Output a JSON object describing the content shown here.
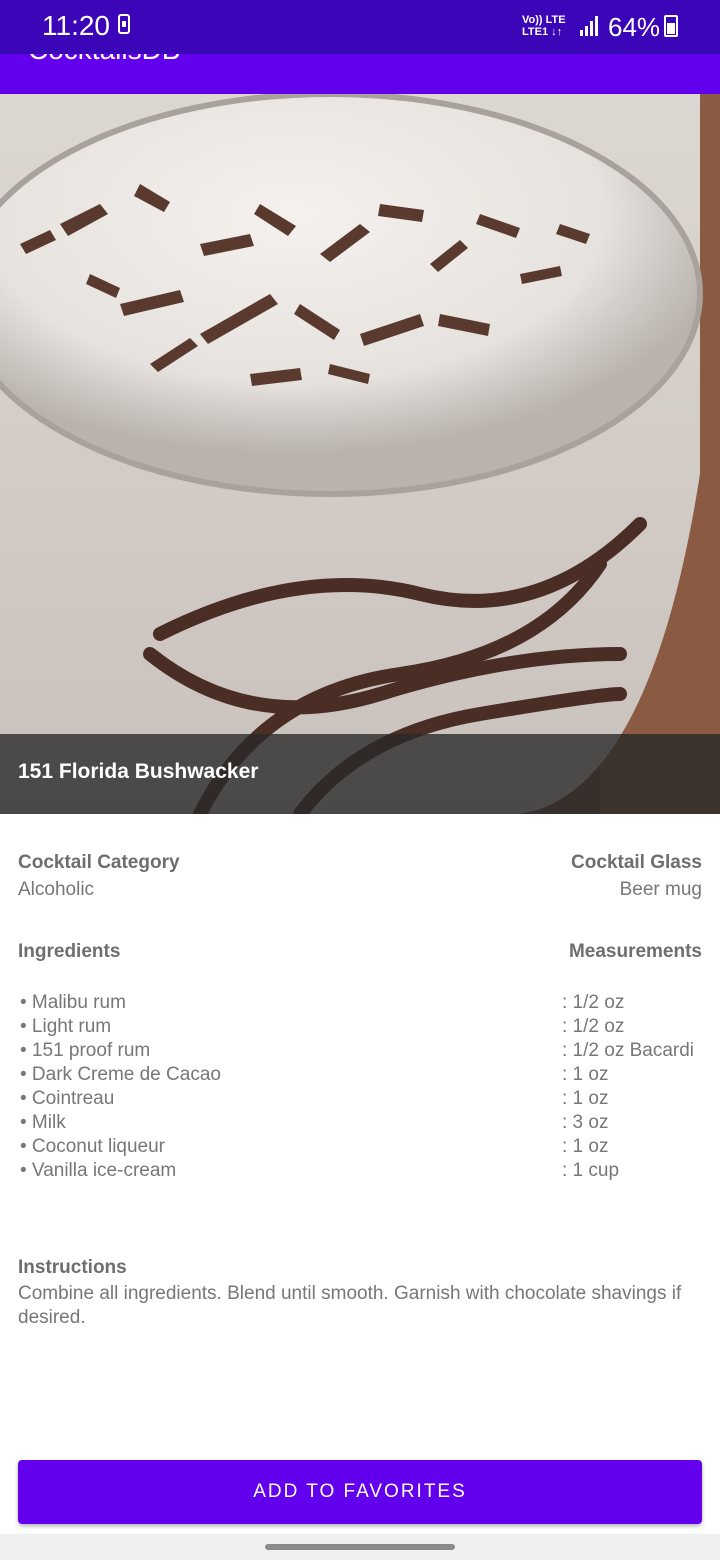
{
  "status_bar": {
    "time": "11:20",
    "network_top": "Vo)) LTE",
    "network_bottom": "LTE1 ↓↑",
    "battery": "64%"
  },
  "app_bar": {
    "title": "CocktailsDB"
  },
  "drink": {
    "name": "151 Florida Bushwacker",
    "image_icon": "cocktail-photo",
    "category_label": "Cocktail Category",
    "category": "Alcoholic",
    "glass_label": "Cocktail Glass",
    "glass": "Beer mug"
  },
  "ingredients_section": {
    "ingredients_label": "Ingredients",
    "measurements_label": "Measurements",
    "ingredients": [
      "• Malibu rum",
      "• Light rum",
      "• 151 proof rum",
      "• Dark Creme de Cacao",
      "• Cointreau",
      "• Milk",
      "• Coconut liqueur",
      "• Vanilla ice-cream"
    ],
    "measurements": [
      ": 1/2 oz",
      ": 1/2 oz",
      ": 1/2 oz Bacardi",
      ": 1 oz",
      ": 1 oz",
      ": 3 oz",
      ": 1 oz",
      ": 1 cup"
    ]
  },
  "instructions": {
    "label": "Instructions",
    "text": "Combine all ingredients. Blend until smooth. Garnish with chocolate shavings if desired."
  },
  "actions": {
    "add_to_favorites": "ADD TO FAVORITES"
  },
  "colors": {
    "primary": "#6200ee",
    "status_bar": "#3a06b8"
  }
}
